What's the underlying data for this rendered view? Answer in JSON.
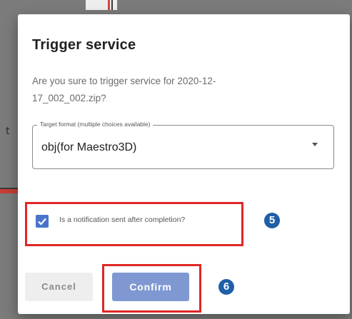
{
  "dialog": {
    "title": "Trigger service",
    "message": "Are you sure to trigger service for 2020-12-17_002_002.zip?",
    "select": {
      "legend": "Target format (multiple choices available)",
      "value": "obj(for Maestro3D)"
    },
    "notify": {
      "label": "Is a notification sent after completion?",
      "checked": true
    },
    "buttons": {
      "cancel": "Cancel",
      "confirm": "Confirm"
    }
  },
  "annotations": {
    "badge_notify": "5",
    "badge_confirm": "6"
  },
  "background": {
    "left_glyph": "t"
  },
  "colors": {
    "accent": "#4a74cc",
    "confirm_button": "#7f98d2",
    "highlight": "#e02626",
    "badge": "#1e5fa8"
  }
}
